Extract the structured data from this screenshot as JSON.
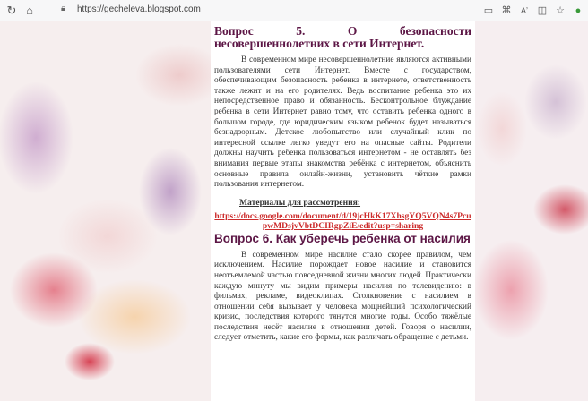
{
  "browser": {
    "url": "https://gecheleva.blogspot.com",
    "icons": {
      "refresh": "refresh-icon",
      "home": "home-icon",
      "lock": "lock-icon",
      "reader": "reader-icon",
      "extensions": "extensions-icon",
      "read_aloud": "read-aloud-icon",
      "split": "split-screen-icon",
      "favorites": "favorites-icon"
    }
  },
  "article": {
    "q5_title": "Вопрос 5. О безопасности несовершеннолетних в сети Интернет.",
    "q5_text": "В современном мире несовершеннолетние являются активными пользователями сети Интернет. Вместе с государством, обеспечивающим безопасность ребенка в интернете, ответственность также лежит и на его родителях. Ведь воспитание ребенка это их непосредственное право и обязанность. Бесконтрольное блуждание ребенка в сети Интернет равно тому, что оставить ребенка одного в большом городе, где юридическим языком ребенок будет называться безнадзорным. Детское любопытство или случайный клик по интересной ссылке легко уведут его на опасные сайты. Родители должны научить ребенка пользоваться интернетом - не оставлять без внимания первые этапы знакомства ребёнка с интернетом, объяснить основные правила онлайн-жизни, установить чёткие рамки пользования интернетом.",
    "materials_label": "Материалы для рассмотрения:",
    "materials_link": "https://docs.google.com/document/d/19jcHkK17XhsgYQ5VQN4s7PcupwMDsjvVbtDCIRgpZiE/edit?usp=sharing",
    "q6_title": "Вопрос 6. Как уберечь ребенка от насилия",
    "q6_text": "В современном мире насилие стало скорее правилом, чем исключением. Насилие порождает новое насилие и становится неотъемлемой частью повседневной жизни многих людей. Практически каждую минуту мы видим примеры насилия по телевидению: в фильмах, рекламе, видеоклипах. Столкновение с насилием в отношении себя вызывает у человека мощнейший психологический кризис, последствия которого тянутся многие годы. Особо тяжёлые последствия несёт насилие в отношении детей. Говоря о насилии, следует отметить, какие его формы, как различать обращение с детьми."
  }
}
